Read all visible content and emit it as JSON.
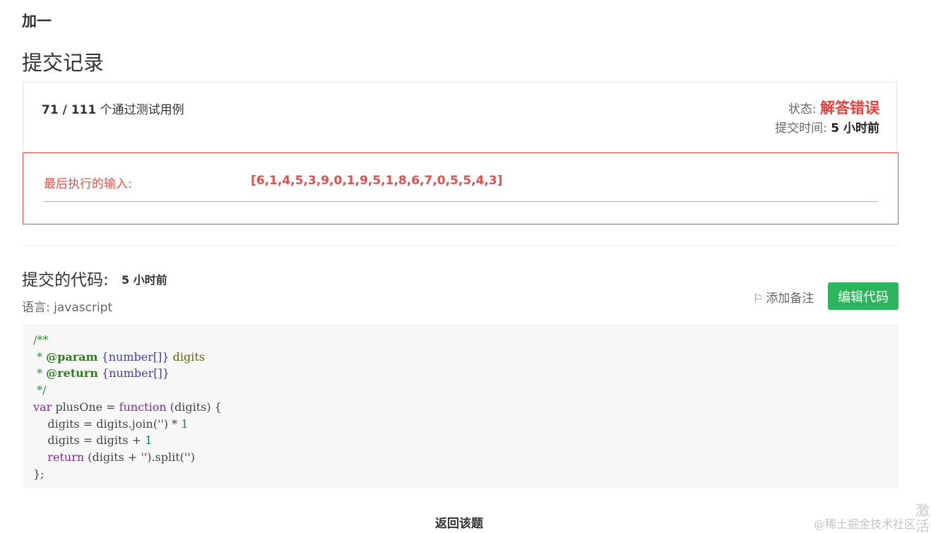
{
  "problem": {
    "title": "加一"
  },
  "section": {
    "title": "提交记录"
  },
  "result": {
    "passed_count": "71 / 111",
    "passed_text": " 个通过测试用例",
    "status_label": "状态:",
    "status_value": "解答错误",
    "submit_time_label": "提交时间:",
    "submit_time_value": "5 小时前"
  },
  "error": {
    "last_input_label": "最后执行的输入:",
    "last_input_value": "[6,1,4,5,3,9,0,1,9,5,1,8,6,7,0,5,5,4,3]"
  },
  "code_section": {
    "heading": "提交的代码:",
    "time_value": "5 小时前",
    "language_label": "语言:",
    "language_value": "javascript",
    "add_note_label": "添加备注",
    "edit_code_label": "编辑代码"
  },
  "code": {
    "line1": "/**",
    "line2_prefix": " * ",
    "line2_tag": "@param",
    "line2_type": "{number[]}",
    "line2_name": "digits",
    "line3_prefix": " * ",
    "line3_tag": "@return",
    "line3_type": "{number[]}",
    "line4": " */",
    "line5_kw1": "var",
    "line5_mid": " plusOne = ",
    "line5_kw2": "function",
    "line5_end": " (digits) {",
    "line6_a": "    digits = digits.join(",
    "line6_str": "''",
    "line6_b": ") * ",
    "line6_num": "1",
    "line7_a": "    digits = digits + ",
    "line7_num": "1",
    "line8_indent": "    ",
    "line8_kw": "return",
    "line8_a": " (digits + ",
    "line8_str1": "''",
    "line8_b": ").split(",
    "line8_str2": "''",
    "line8_c": ")",
    "line9": "};"
  },
  "footer": {
    "back_label": "返回该题",
    "watermark": "@稀土掘金技术社区",
    "side_text": "激活"
  },
  "icons": {
    "note": "flag-icon"
  },
  "colors": {
    "error": "#d9534f",
    "status": "#e2413f",
    "edit_button": "#2db55d",
    "code_bg": "#f7f7f7"
  }
}
